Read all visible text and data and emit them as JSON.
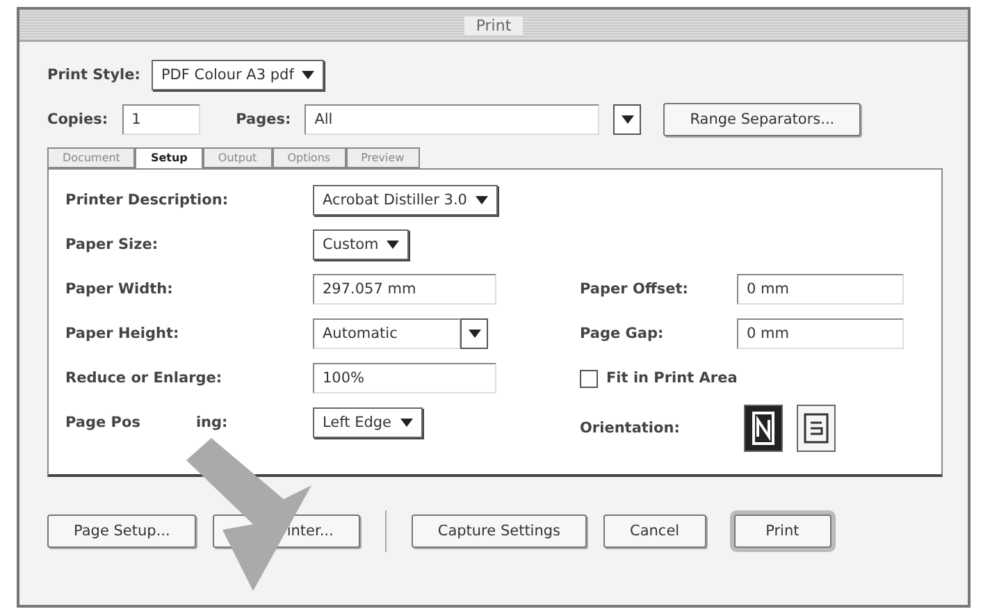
{
  "window": {
    "title": "Print"
  },
  "print_style": {
    "label": "Print Style:",
    "value": "PDF Colour A3 pdf"
  },
  "copies": {
    "label": "Copies:",
    "value": "1"
  },
  "pages": {
    "label": "Pages:",
    "value": "All"
  },
  "range_button": "Range Separators...",
  "tabs": [
    {
      "label": "Document",
      "selected": false
    },
    {
      "label": "Setup",
      "selected": true
    },
    {
      "label": "Output",
      "selected": false
    },
    {
      "label": "Options",
      "selected": false
    },
    {
      "label": "Preview",
      "selected": false
    }
  ],
  "setup": {
    "printer_description": {
      "label": "Printer Description:",
      "value": "Acrobat Distiller 3.0"
    },
    "paper_size": {
      "label": "Paper Size:",
      "value": "Custom"
    },
    "paper_width": {
      "label": "Paper Width:",
      "value": "297.057 mm"
    },
    "paper_height": {
      "label": "Paper Height:",
      "value": "Automatic"
    },
    "reduce": {
      "label": "Reduce or Enlarge:",
      "value": "100%"
    },
    "positioning": {
      "label_start": "Page Pos",
      "label_end": "ing:",
      "value": "Left Edge"
    },
    "paper_offset": {
      "label": "Paper Offset:",
      "value": "0 mm"
    },
    "page_gap": {
      "label": "Page Gap:",
      "value": "0 mm"
    },
    "fit": {
      "label": "Fit in Print Area",
      "checked": false
    },
    "orientation": {
      "label": "Orientation:",
      "options": [
        {
          "kind": "portrait",
          "selected": true
        },
        {
          "kind": "landscape",
          "selected": false
        }
      ]
    }
  },
  "buttons": [
    {
      "label": "Page Setup...",
      "default": false
    },
    {
      "label": "inter...",
      "default": false
    },
    {
      "label": "Capture Settings",
      "default": false
    },
    {
      "label": "Cancel",
      "default": false
    },
    {
      "label": "Print",
      "default": true
    }
  ]
}
